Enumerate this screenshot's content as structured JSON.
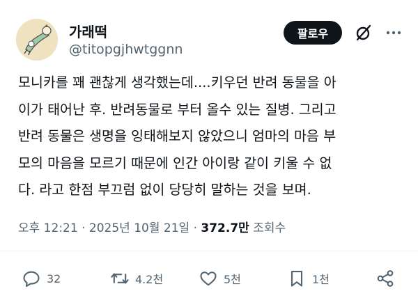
{
  "author": {
    "display_name": "가래떡",
    "handle": "@titopgjhwtggnn",
    "avatar_icon": "avatar-illustration-icon"
  },
  "header": {
    "follow_label": "팔로우",
    "grok_icon": "grok-icon",
    "more_icon": "more-dots-icon"
  },
  "tweet": {
    "lines": [
      "모니카를 꽤 괜찮게 생각했는데....키우던 반려 동물을 아",
      "이가 태어난 후. 반려동물로 부터 올수 있는 질병. 그리고",
      "반려 동물은 생명을 잉태해보지 않았으니 엄마의 마음 부",
      "모의 마음을 모르기 때문에 인간 아이랑 같이 키울 수 없",
      "다. 라고 한점 부끄럼 없이 당당히 말하는 것을 보며."
    ]
  },
  "meta": {
    "time": "오후 12:21",
    "separator": "·",
    "date": "2025년 10월 21일",
    "views_count": "372.7만",
    "views_label": "조회수"
  },
  "actions": {
    "reply": {
      "icon": "reply-icon",
      "count": "32"
    },
    "retweet": {
      "icon": "retweet-icon",
      "count": "4.2천"
    },
    "like": {
      "icon": "heart-icon",
      "count": "5천"
    },
    "bookmark": {
      "icon": "bookmark-icon",
      "count": "1천"
    },
    "share": {
      "icon": "share-icon"
    }
  },
  "colors": {
    "text": "#0f1419",
    "secondary": "#536471",
    "button_bg": "#0f1419",
    "divider": "#eff3f4"
  }
}
